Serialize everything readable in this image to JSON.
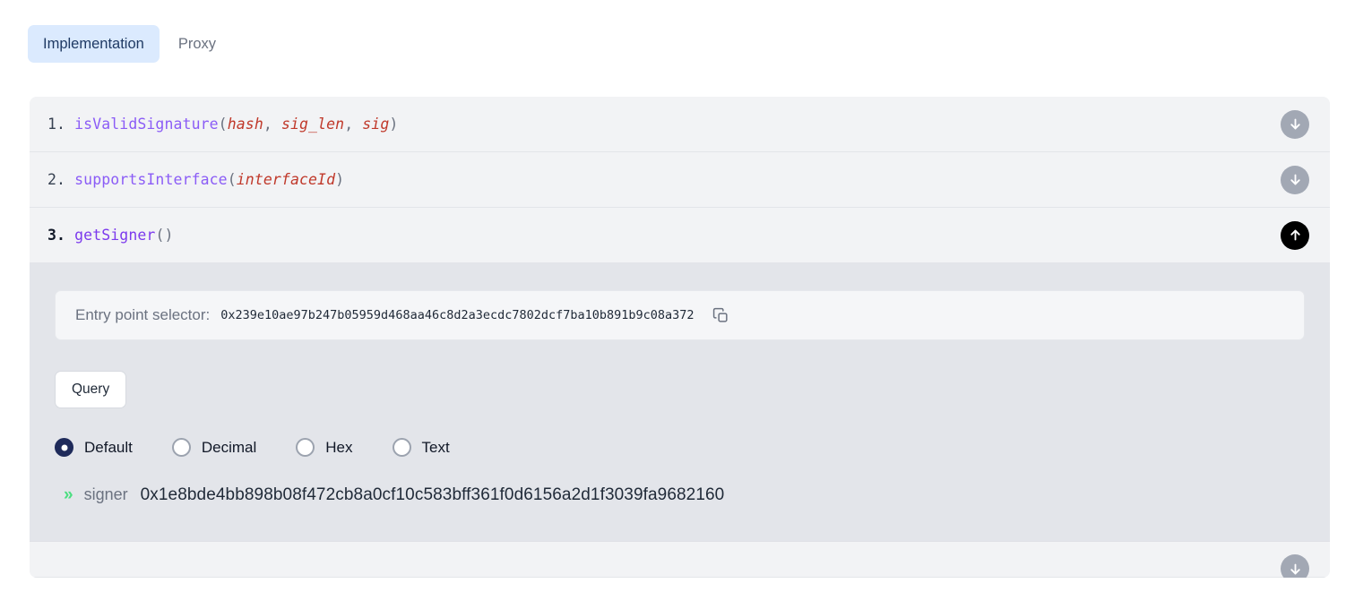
{
  "tabs": [
    {
      "label": "Implementation",
      "active": true
    },
    {
      "label": "Proxy",
      "active": false
    }
  ],
  "functions": [
    {
      "index": "1.",
      "name": "isValidSignature",
      "args": [
        "hash",
        "sig_len",
        "sig"
      ],
      "expanded": false,
      "arrow": "down-arrow-icon"
    },
    {
      "index": "2.",
      "name": "supportsInterface",
      "args": [
        "interfaceId"
      ],
      "expanded": false,
      "arrow": "down-arrow-icon"
    },
    {
      "index": "3.",
      "name": "getSigner",
      "args": [],
      "expanded": true,
      "arrow": "up-arrow-icon"
    }
  ],
  "detail": {
    "selector_label": "Entry point selector:",
    "selector_value": "0x239e10ae97b247b05959d468aa46c8d2a3ecdc7802dcf7ba10b891b9c08a372",
    "copy_icon": "copy-icon",
    "query_label": "Query",
    "formats": [
      {
        "label": "Default",
        "selected": true
      },
      {
        "label": "Decimal",
        "selected": false
      },
      {
        "label": "Hex",
        "selected": false
      },
      {
        "label": "Text",
        "selected": false
      }
    ],
    "result": {
      "chevrons": "»",
      "key": "signer",
      "value": "0x1e8bde4bb898b08f472cb8a0cf10c583bff361f0d6156a2d1f3039fa9682160"
    }
  },
  "colors": {
    "tab_active_bg": "#dbeafe",
    "tab_active_text": "#1f3a64",
    "function_name": "#8b5cf6",
    "argument": "#c0392b",
    "arrow_open_bg": "#000000",
    "arrow_closed_bg": "#a2a8b4",
    "radio_selected": "#1e2a5a",
    "result_chevron": "#4ade80"
  }
}
